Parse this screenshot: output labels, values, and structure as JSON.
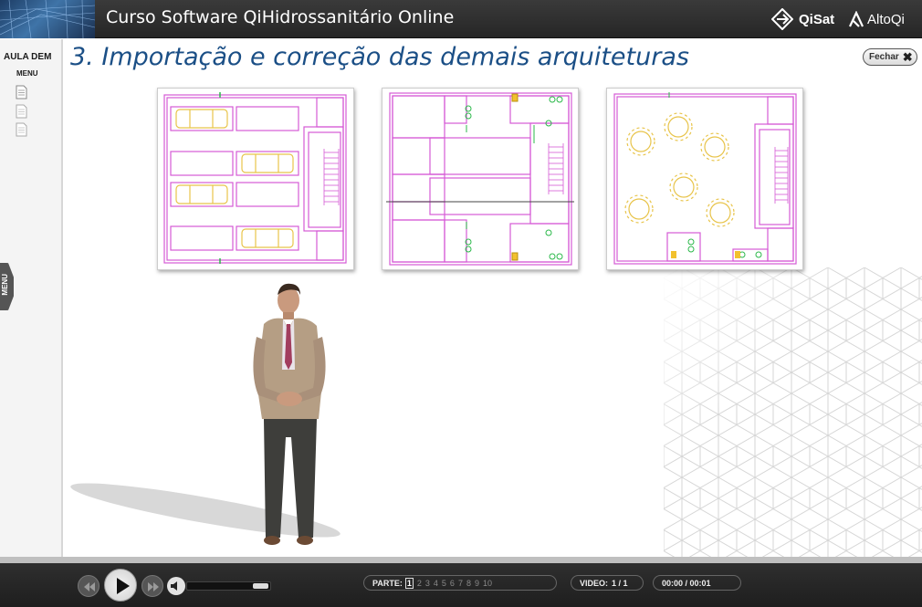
{
  "header": {
    "course_title": "Curso Software QiHidrossanitário Online",
    "logo_qisat": "QiSat",
    "logo_altoqi": "AltoQi"
  },
  "left_menu": {
    "aula_label": "AULA DEM",
    "menu_label": "MENU",
    "tab_label": "MENU",
    "doc_items": [
      "document-icon",
      "document-icon",
      "document-icon"
    ]
  },
  "slide": {
    "title": "3. Importação e correção das demais arquiteturas",
    "close_label": "Fechar"
  },
  "plans": [
    {
      "name": "floor-plan-garage"
    },
    {
      "name": "floor-plan-apartments"
    },
    {
      "name": "floor-plan-hall"
    }
  ],
  "player": {
    "parte_label": "PARTE:",
    "parts": [
      "1",
      "2",
      "3",
      "4",
      "5",
      "6",
      "7",
      "8",
      "9",
      "10"
    ],
    "active_part": "1",
    "video_label": "VIDEO:",
    "video_value": "1 / 1",
    "time_value": "00:00 / 00:01",
    "volume": 0.8
  },
  "colors": {
    "title_blue": "#1b4f86",
    "header_bg": "#2a2a2a",
    "plan_wall": "#d65ad6",
    "plan_car": "#e8c44a"
  }
}
